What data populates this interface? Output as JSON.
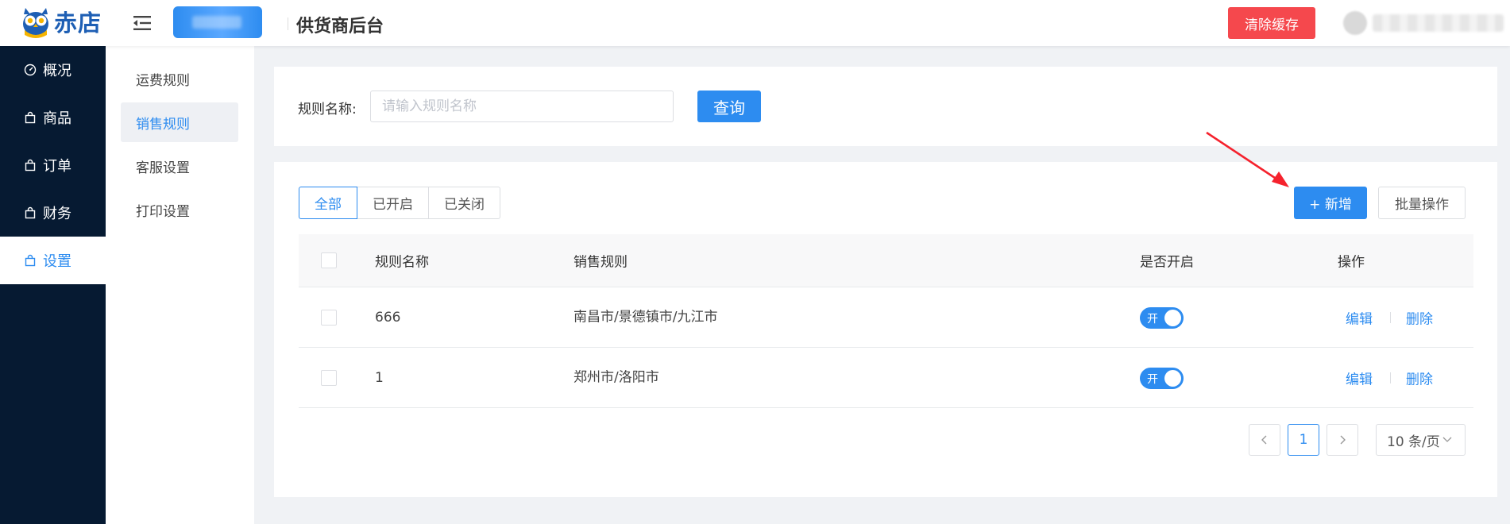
{
  "header": {
    "logo_text": "赤店",
    "title": "供货商后台",
    "clear_cache_label": "清除缓存"
  },
  "sidebar": {
    "items": [
      {
        "label": "概况",
        "icon": "dashboard-icon"
      },
      {
        "label": "商品",
        "icon": "bag-icon"
      },
      {
        "label": "订单",
        "icon": "bag-icon"
      },
      {
        "label": "财务",
        "icon": "bag-icon"
      },
      {
        "label": "设置",
        "icon": "bag-icon",
        "active": true
      }
    ]
  },
  "subnav": {
    "items": [
      {
        "label": "运费规则"
      },
      {
        "label": "销售规则",
        "active": true
      },
      {
        "label": "客服设置"
      },
      {
        "label": "打印设置"
      }
    ]
  },
  "search": {
    "label": "规则名称:",
    "placeholder": "请输入规则名称",
    "value": "",
    "query_label": "查询"
  },
  "filters": {
    "tabs": [
      {
        "label": "全部",
        "active": true
      },
      {
        "label": "已开启"
      },
      {
        "label": "已关闭"
      }
    ],
    "add_label": "+ 新增",
    "batch_label": "批量操作"
  },
  "table": {
    "columns": [
      "规则名称",
      "销售规则",
      "是否开启",
      "操作"
    ],
    "rows": [
      {
        "name": "666",
        "rule": "南昌市/景德镇市/九江市",
        "switch_text": "开",
        "edit": "编辑",
        "delete": "删除"
      },
      {
        "name": "1",
        "rule": "郑州市/洛阳市",
        "switch_text": "开",
        "edit": "编辑",
        "delete": "删除"
      }
    ]
  },
  "pagination": {
    "current_page": "1",
    "page_size": "10 条/页"
  },
  "colors": {
    "primary": "#2d8cf0",
    "danger": "#f5484d",
    "sidebar_bg": "#061a32",
    "annotation_arrow": "#f5222d"
  }
}
